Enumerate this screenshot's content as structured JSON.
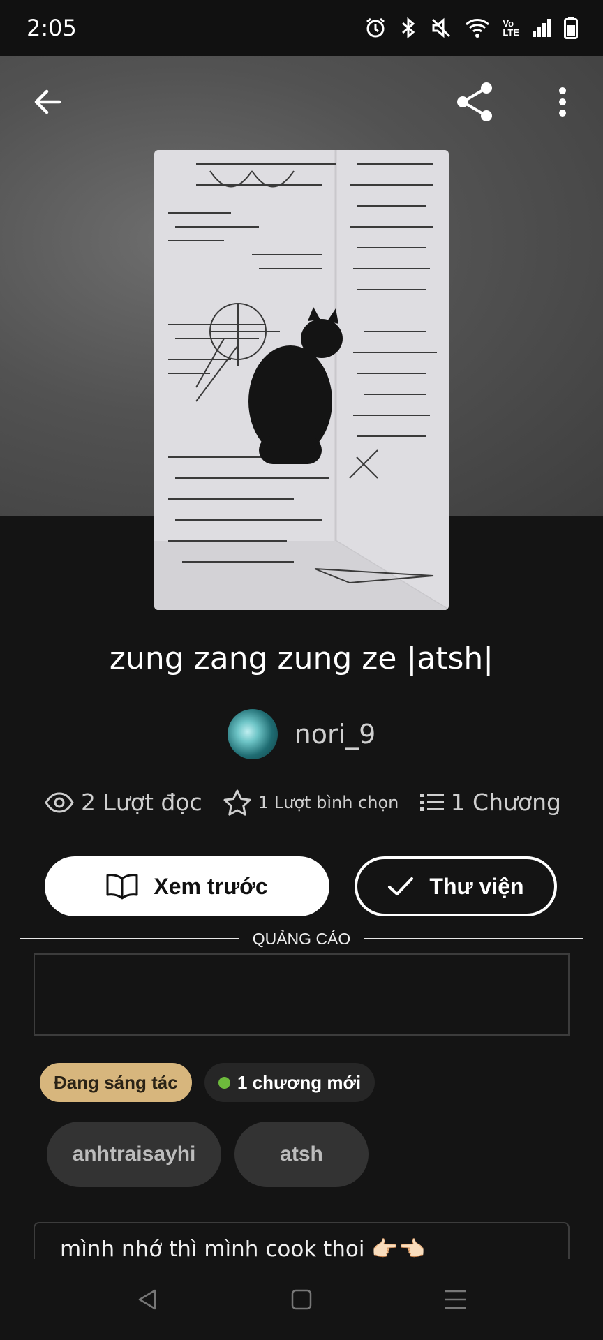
{
  "status_bar": {
    "time": "2:05",
    "icons": [
      "alarm-icon",
      "bluetooth-icon",
      "mute-icon",
      "wifi-icon",
      "volte-icon",
      "signal-icon",
      "battery-icon"
    ],
    "volte_text_top": "Vo",
    "volte_text_bottom": "LTE"
  },
  "toolbar": {
    "back_icon": "arrow-left-icon",
    "share_icon": "share-icon",
    "more_icon": "more-vertical-icon"
  },
  "story": {
    "title": "zung zang zung ze |atsh|",
    "author": "nori_9",
    "stats": {
      "reads": "2 Lượt đọc",
      "votes": "1 Lượt bình chọn",
      "chapters": "1 Chương"
    },
    "preview_button": "Xem trước",
    "library_button": "Thư viện",
    "ad_label": "QUẢNG CÁO",
    "status_chip": "Đang sáng tác",
    "new_chapter_chip": "1 chương mới",
    "tags": [
      "anhtraisayhi",
      "atsh"
    ],
    "description": "mình nhớ thì mình cook thoi 👉🏻👈🏻"
  },
  "colors": {
    "background": "#141414",
    "status_chip": "#d7b67d",
    "new_dot": "#6dbb3c",
    "tag_bg": "#333333"
  }
}
